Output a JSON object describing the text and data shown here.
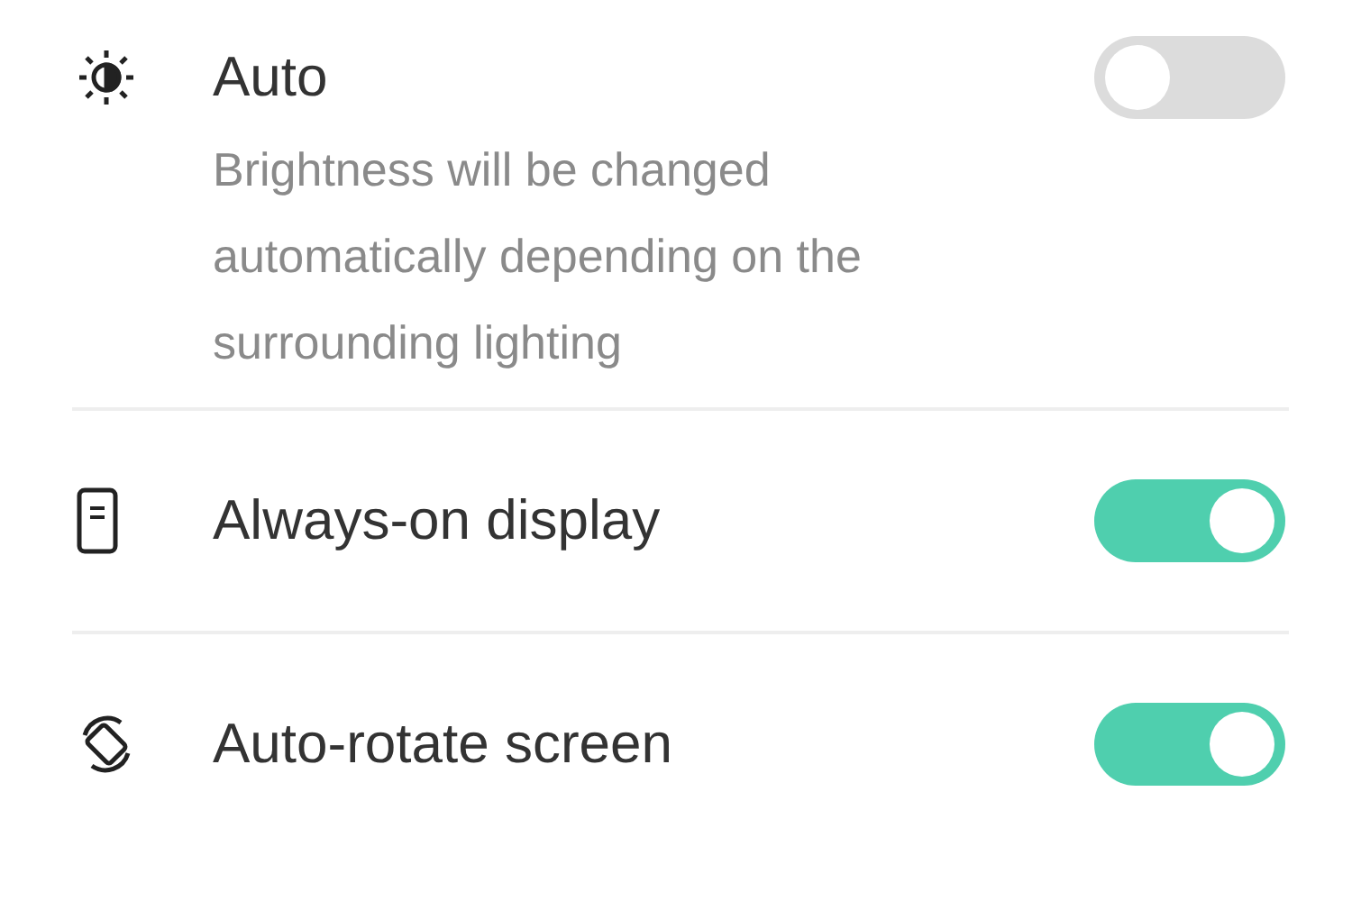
{
  "settings": [
    {
      "kind": "brightness",
      "label": "Auto",
      "description": "Brightness will be changed automatically depending on the surrounding lighting",
      "on": false
    },
    {
      "kind": "display",
      "label": "Always-on display",
      "on": true
    },
    {
      "kind": "rotate",
      "label": "Auto-rotate screen",
      "on": true
    }
  ]
}
